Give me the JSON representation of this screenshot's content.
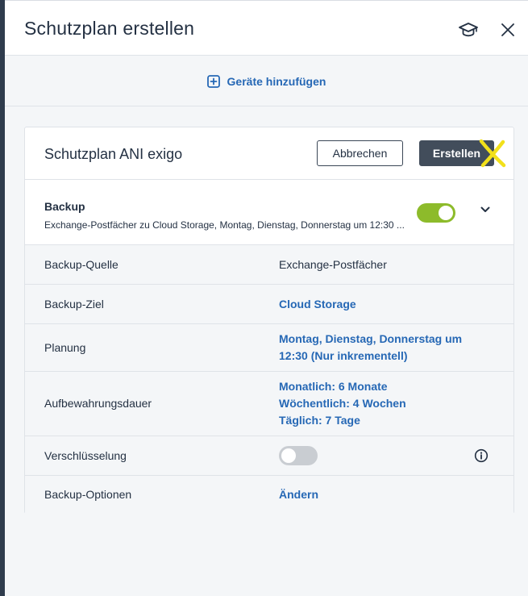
{
  "header": {
    "title": "Schutzplan erstellen",
    "hat_icon": "graduation-cap-icon",
    "close_icon": "close-icon"
  },
  "add_devices": {
    "label": "Geräte hinzufügen",
    "icon": "plus-square-icon"
  },
  "plan": {
    "name": "Schutzplan ANI exigo",
    "cancel_label": "Abbrechen",
    "create_label": "Erstellen"
  },
  "backup": {
    "title": "Backup",
    "summary": "Exchange-Postfächer zu Cloud Storage, Montag, Dienstag, Donnerstag um 12:30 ...",
    "enabled": true
  },
  "rows": {
    "source": {
      "label": "Backup-Quelle",
      "value": "Exchange-Postfächer"
    },
    "target": {
      "label": "Backup-Ziel",
      "value": "Cloud Storage"
    },
    "schedule": {
      "label": "Planung",
      "value_line1": "Montag, Dienstag, Donnerstag um",
      "value_line2": "12:30 (Nur inkrementell)"
    },
    "retention": {
      "label": "Aufbewahrungsdauer",
      "monthly": "Monatlich: 6 Monate",
      "weekly": "Wöchentlich: 4 Wochen",
      "daily": "Täglich: 7 Tage"
    },
    "encryption": {
      "label": "Verschlüsselung",
      "enabled": false
    },
    "options": {
      "label": "Backup-Optionen",
      "value": "Ändern"
    }
  },
  "colors": {
    "accent_link": "#2668b5",
    "toggle_on": "#8dbb2b",
    "toggle_off": "#c9cdd2",
    "primary_button": "#424d5b",
    "annotation_mark": "#f2e01a"
  }
}
